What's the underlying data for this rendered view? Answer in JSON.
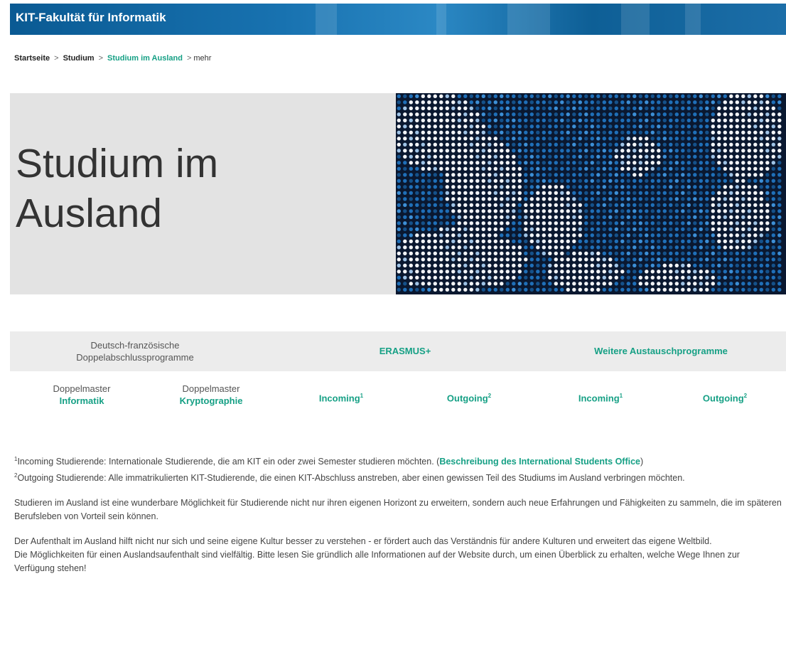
{
  "header": {
    "title": "KIT-Fakultät für Informatik"
  },
  "breadcrumb": [
    "Startseite",
    "Studium",
    "Studium im Ausland",
    "mehr"
  ],
  "hero": {
    "title_line1": "Studium im",
    "title_line2": "Ausland"
  },
  "programs": {
    "groups": [
      "Deutsch-französische",
      "Doppelabschlussprogramme",
      "ERASMUS+",
      "Weitere Austauschprogramme"
    ],
    "sub": [
      {
        "label": "Doppelmaster",
        "link": "Informatik"
      },
      {
        "label": "Doppelmaster",
        "link": "Kryptographie"
      }
    ],
    "incoming": "Incoming",
    "outgoing": "Outgoing",
    "sup1": "1",
    "sup2": "2"
  },
  "notes": {
    "n1_sup": "1",
    "n1_text": "Incoming Studierende: Internationale Studierende, die am KIT ein oder zwei Semester studieren möchten. (",
    "n1_link": "Beschreibung des International Students Office",
    "n1_end": ")",
    "n2_sup": "2",
    "n2_text": "Outgoing Studierende:  Alle immatrikulierten KIT-Studierende, die einen KIT-Abschluss anstreben, aber einen gewissen Teil des Studiums im Ausland verbringen möchten.",
    "p1": "Studieren im Ausland ist eine wunderbare Möglichkeit für Studierende nicht nur ihren eigenen Horizont zu erweitern, sondern auch neue Erfahrungen und Fähigkeiten zu sammeln, die im späteren Berufsleben von Vorteil sein können.",
    "p2": "Der Aufenthalt im Ausland hilft nicht nur sich und seine eigene Kultur besser zu verstehen - er fördert auch das Verständnis für andere Kulturen und erweitert das eigene Weltbild.",
    "p3": "Die Möglichkeiten für einen Auslandsaufenthalt sind vielfältig. Bitte lesen Sie gründlich alle Informationen auf der Website durch, um einen Überblick zu erhalten, welche Wege Ihnen zur Verfügung stehen!"
  }
}
